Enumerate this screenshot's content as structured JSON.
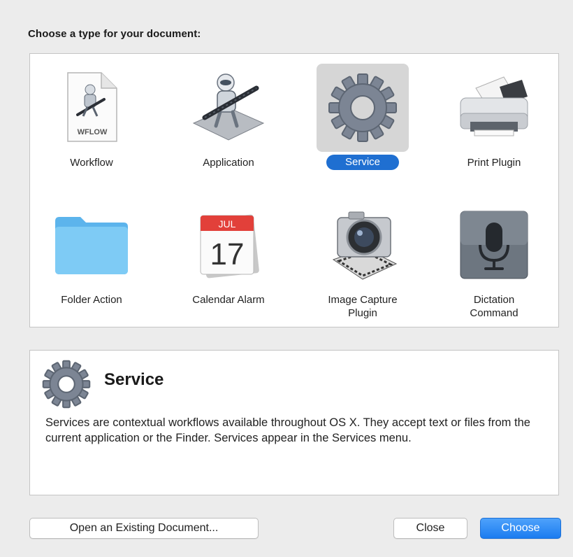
{
  "dialog": {
    "prompt": "Choose a type for your document:"
  },
  "document_types": [
    {
      "label": "Workflow",
      "icon": "workflow-file-icon",
      "icon_text": "WFLOW"
    },
    {
      "label": "Application",
      "icon": "automator-robot-icon"
    },
    {
      "label": "Service",
      "icon": "gear-icon",
      "selected": true
    },
    {
      "label": "Print Plugin",
      "icon": "printer-icon"
    },
    {
      "label": "Folder Action",
      "icon": "folder-icon"
    },
    {
      "label": "Calendar Alarm",
      "icon": "calendar-icon",
      "icon_month": "JUL",
      "icon_day": "17"
    },
    {
      "label": "Image Capture\nPlugin",
      "icon": "camera-icon"
    },
    {
      "label": "Dictation\nCommand",
      "icon": "microphone-icon"
    }
  ],
  "description": {
    "title": "Service",
    "icon": "gear-icon",
    "text": "Services are contextual workflows available throughout OS X. They accept text or files from the current application or the Finder. Services appear in the Services menu."
  },
  "buttons": {
    "open_existing": "Open an Existing Document...",
    "close": "Close",
    "choose": "Choose"
  },
  "colors": {
    "accent": "#1f6fd1",
    "background": "#ececec",
    "panel": "#ffffff"
  }
}
